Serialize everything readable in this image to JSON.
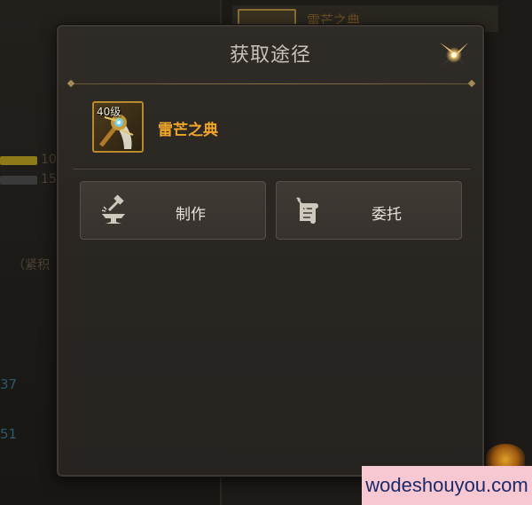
{
  "dialog": {
    "title": "获取途径",
    "close_icon": "close-x-star-icon"
  },
  "item": {
    "level": "40级",
    "name": "雷芒之典",
    "icon": "staff-weapon-icon"
  },
  "actions": [
    {
      "label": "制作",
      "icon": "anvil-hammer-icon"
    },
    {
      "label": "委托",
      "icon": "scroll-quill-icon"
    }
  ],
  "background": {
    "header_item": "雷芒之典",
    "stats": [
      "10",
      "15"
    ],
    "note": "（紧积",
    "numbers": [
      "37",
      "51"
    ]
  },
  "watermark": "wodeshouyou.com",
  "colors": {
    "item_name": "#f0a62a",
    "slot_border": "#b88a2e",
    "dialog_bg": "#2a2622",
    "watermark_bg": "#f8c8d2"
  }
}
